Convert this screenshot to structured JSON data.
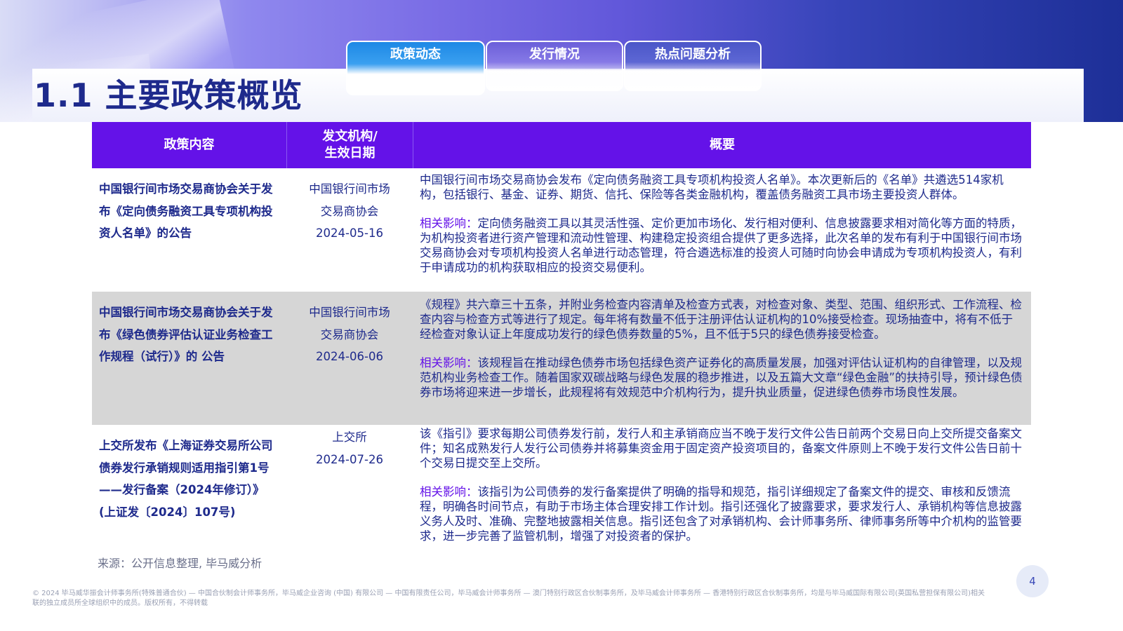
{
  "tabs": [
    {
      "label": "政策动态"
    },
    {
      "label": "发行情况"
    },
    {
      "label": "热点问题分析"
    }
  ],
  "page_title": "1.1 主要政策概览",
  "table": {
    "headers": [
      "政策内容",
      "发文机构/\n生效日期",
      "概要"
    ],
    "rows": [
      {
        "policy": "中国银行间市场交易商协会关于发布《定向债务融资工具专项机构投资人名单》的公告",
        "org": "中国银行间市场交易商协会",
        "date": "2024-05-16",
        "summary": "中国银行间市场交易商协会发布《定向债务融资工具专项机构投资人名单》。本次更新后的《名单》共遴选514家机构，包括银行、基金、证券、期货、信托、保险等各类金融机构，覆盖债务融资工具市场主要投资人群体。",
        "impact_label": "相关影响：",
        "impact": "定向债务融资工具以其灵活性强、定价更加市场化、发行相对便利、信息披露要求相对简化等方面的特质，为机构投资者进行资产管理和流动性管理、构建稳定投资组合提供了更多选择，此次名单的发布有利于中国银行间市场交易商协会对专项机构投资人名单进行动态管理，符合遴选标准的投资人可随时向协会申请成为专项机构投资人，有利于申请成功的机构获取相应的投资交易便利。"
      },
      {
        "policy": "中国银行间市场交易商协会关于发布《绿色债券评估认证业务检查工作规程（试行）》的 公告",
        "org": "中国银行间市场交易商协会",
        "date": "2024-06-06",
        "summary": "《规程》共六章三十五条，并附业务检查内容清单及检查方式表，对检查对象、类型、范围、组织形式、工作流程、检查内容与检查方式等进行了规定。每年将有数量不低于注册评估认证机构的10%接受检查。现场抽查中，将有不低于经检查对象认证上年度成功发行的绿色债券数量的5%，且不低于5只的绿色债券接受检查。",
        "impact_label": "相关影响：",
        "impact": "该规程旨在推动绿色债券市场包括绿色资产证券化的高质量发展，加强对评估认证机构的自律管理，以及规范机构业务检查工作。随着国家双碳战略与绿色发展的稳步推进，以及五篇大文章“绿色金融”的扶持引导，预计绿色债券市场将迎来进一步增长，此规程将有效规范中介机构行为，提升执业质量，促进绿色债券市场良性发展。"
      },
      {
        "policy": "上交所发布《上海证券交易所公司债券发行承销规则适用指引第1号——发行备案（2024年修订）》(上证发〔2024〕107号)",
        "org": "上交所",
        "date": "2024-07-26",
        "summary": "该《指引》要求每期公司债券发行前，发行人和主承销商应当不晚于发行文件公告日前两个交易日向上交所提交备案文件；知名成熟发行人发行公司债券并将募集资金用于固定资产投资项目的，备案文件原则上不晚于发行文件公告日前十个交易日提交至上交所。",
        "impact_label": "相关影响：",
        "impact": "该指引为公司债券的发行备案提供了明确的指导和规范，指引详细规定了备案文件的提交、审核和反馈流程，明确各时间节点，有助于市场主体合理安排工作计划。指引还强化了披露要求，要求发行人、承销机构等信息披露义务人及时、准确、完整地披露相关信息。指引还包含了对承销机构、会计师事务所、律师事务所等中介机构的监管要求，进一步完善了监管机制，增强了对投资者的保护。"
      }
    ]
  },
  "source": "来源：公开信息整理, 毕马威分析",
  "footer": "© 2024 毕马威华振会计师事务所(特殊普通合伙) — 中国合伙制会计师事务所，毕马威企业咨询 (中国) 有限公司 — 中国有限责任公司，毕马威会计师事务所 — 澳门特别行政区合伙制事务所，及毕马威会计师事务所 — 香港特别行政区合伙制事务所，均是与毕马威国际有限公司(英国私营担保有限公司)相关联的独立成员所全球组织中的成员。版权所有，不得转载",
  "page_number": "4",
  "colors": {
    "primary": "#1e2a8c",
    "header": "#6412e8",
    "accent": "#6412e8",
    "shade": "#d6d6d6"
  }
}
